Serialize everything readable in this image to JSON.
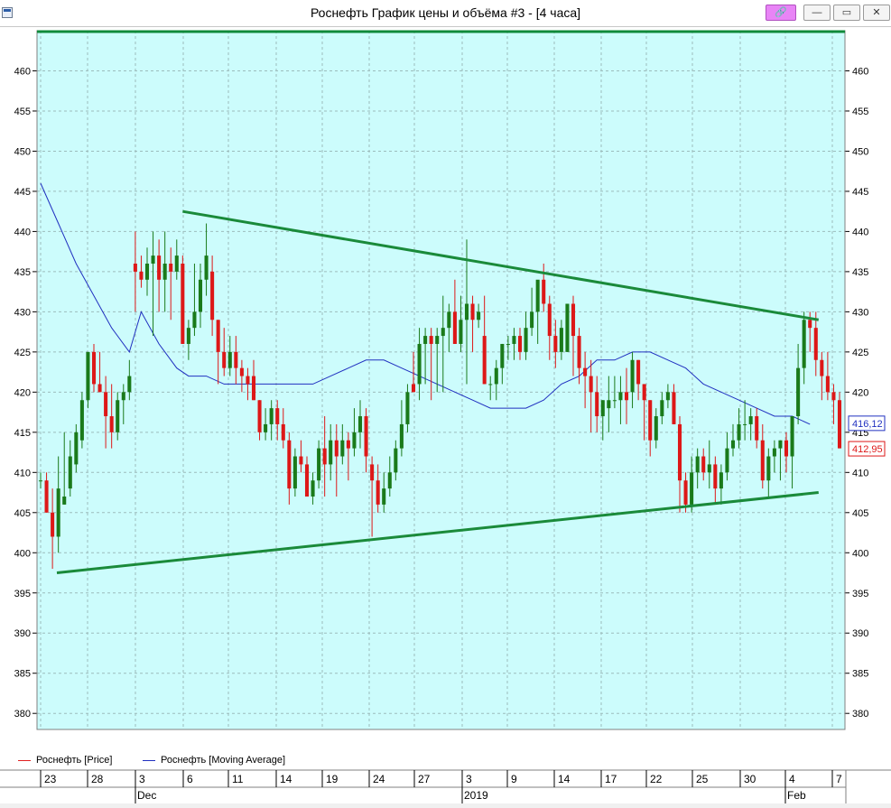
{
  "window": {
    "title": "Роснефть График цены и объёма #3 - [4 часа]",
    "buttons": {
      "link": "🔗",
      "minimize": "—",
      "maximize": "▭",
      "close": "✕"
    }
  },
  "legend": [
    {
      "label": "Роснефть [Price]",
      "color": "#e02020"
    },
    {
      "label": "Роснефть [Moving Average]",
      "color": "#2030c0"
    }
  ],
  "colors": {
    "background": "#ccfcfc",
    "up": "#1a7a1a",
    "down": "#dd1818",
    "trendline": "#1a8a3a",
    "ma": "#2030c0",
    "frame": "#0f8a3a",
    "grid": "#9cbcbc"
  },
  "chart_data": {
    "type": "candlestick",
    "ylim": [
      378,
      465
    ],
    "yticks": [
      380,
      385,
      390,
      395,
      400,
      405,
      410,
      415,
      420,
      425,
      430,
      435,
      440,
      445,
      450,
      455,
      460
    ],
    "xlabels": [
      "23",
      "28",
      "3",
      "6",
      "11",
      "14",
      "19",
      "24",
      "27",
      "3",
      "9",
      "14",
      "17",
      "22",
      "25",
      "30",
      "4",
      "7"
    ],
    "month_labels": [
      {
        "label": "Dec",
        "at": 2
      },
      {
        "label": "2019",
        "at": 9
      },
      {
        "label": "Feb",
        "at": 16
      }
    ],
    "last_price": "412,95",
    "last_ma": "416,12",
    "candles": [
      [
        409,
        410,
        408,
        409
      ],
      [
        409,
        410,
        405,
        405
      ],
      [
        405,
        408,
        398,
        402
      ],
      [
        402,
        412,
        400,
        408
      ],
      [
        406,
        415,
        406,
        407
      ],
      [
        408,
        414,
        407,
        412
      ],
      [
        411,
        416,
        410,
        415
      ],
      [
        414,
        420,
        413,
        419
      ],
      [
        419,
        425,
        418,
        425
      ],
      [
        425,
        426,
        420,
        421
      ],
      [
        421,
        425,
        420,
        420
      ],
      [
        420,
        422,
        413,
        417
      ],
      [
        417,
        421,
        413,
        415
      ],
      [
        415,
        420,
        414,
        419
      ],
      [
        419,
        421,
        416,
        420
      ],
      [
        420,
        424,
        419,
        422
      ],
      [
        436,
        440,
        430,
        435
      ],
      [
        435,
        437,
        433,
        434
      ],
      [
        434,
        438,
        432,
        436
      ],
      [
        436,
        440,
        427,
        437
      ],
      [
        437,
        439,
        430,
        434
      ],
      [
        434,
        440,
        430,
        436
      ],
      [
        436,
        438,
        429,
        435
      ],
      [
        435,
        439,
        434,
        437
      ],
      [
        436,
        437,
        426,
        426
      ],
      [
        426,
        429,
        424,
        428
      ],
      [
        428,
        436,
        427,
        430
      ],
      [
        430,
        436,
        428,
        434
      ],
      [
        434,
        441,
        432,
        437
      ],
      [
        435,
        437,
        427,
        429
      ],
      [
        429,
        429,
        421,
        425
      ],
      [
        425,
        428,
        422,
        423
      ],
      [
        423,
        427,
        422,
        425
      ],
      [
        425,
        427,
        421,
        423
      ],
      [
        423,
        424,
        420,
        422
      ],
      [
        422,
        423,
        419,
        421
      ],
      [
        422,
        424,
        419,
        419
      ],
      [
        419,
        419,
        414,
        415
      ],
      [
        415,
        418,
        414,
        416
      ],
      [
        416,
        419,
        414,
        418
      ],
      [
        418,
        419,
        414,
        416
      ],
      [
        416,
        418,
        413,
        414
      ],
      [
        414,
        415,
        406,
        408
      ],
      [
        408,
        413,
        407,
        412
      ],
      [
        412,
        414,
        410,
        411
      ],
      [
        411,
        412,
        407,
        407
      ],
      [
        407,
        410,
        406,
        409
      ],
      [
        409,
        414,
        408,
        413
      ],
      [
        413,
        417,
        407,
        411
      ],
      [
        411,
        416,
        409,
        414
      ],
      [
        414,
        416,
        407,
        412
      ],
      [
        412,
        416,
        411,
        414
      ],
      [
        414,
        415,
        409,
        413
      ],
      [
        413,
        418,
        412,
        415
      ],
      [
        415,
        419,
        413,
        417
      ],
      [
        417,
        418,
        410,
        412
      ],
      [
        411,
        412,
        402,
        409
      ],
      [
        409,
        411,
        405,
        406
      ],
      [
        406,
        410,
        405,
        408
      ],
      [
        408,
        412,
        407,
        410
      ],
      [
        410,
        414,
        409,
        413
      ],
      [
        413,
        419,
        412,
        416
      ],
      [
        416,
        421,
        415,
        420
      ],
      [
        421,
        425,
        420,
        420
      ],
      [
        421,
        428,
        419,
        426
      ],
      [
        426,
        428,
        421,
        427
      ],
      [
        427,
        428,
        419,
        426
      ],
      [
        426,
        428,
        420,
        427
      ],
      [
        427,
        432,
        420,
        428
      ],
      [
        428,
        431,
        425,
        430
      ],
      [
        430,
        434,
        426,
        426
      ],
      [
        426,
        432,
        425,
        429
      ],
      [
        429,
        439,
        421,
        431
      ],
      [
        431,
        432,
        425,
        429
      ],
      [
        429,
        431,
        428,
        430
      ],
      [
        427,
        432,
        421,
        421
      ],
      [
        421,
        422,
        419,
        421
      ],
      [
        421,
        424,
        419,
        423
      ],
      [
        423,
        426,
        421,
        426
      ],
      [
        426,
        427,
        424,
        426
      ],
      [
        426,
        428,
        424,
        427
      ],
      [
        427,
        428,
        424,
        425
      ],
      [
        425,
        430,
        424,
        428
      ],
      [
        428,
        433,
        427,
        430
      ],
      [
        430,
        432,
        426,
        434
      ],
      [
        434,
        436,
        430,
        431
      ],
      [
        431,
        432,
        424,
        427
      ],
      [
        427,
        429,
        423,
        425
      ],
      [
        425,
        429,
        424,
        428
      ],
      [
        425,
        431,
        425,
        431
      ],
      [
        431,
        432,
        422,
        427
      ],
      [
        427,
        428,
        421,
        423
      ],
      [
        423,
        425,
        418,
        422
      ],
      [
        422,
        424,
        415,
        420
      ],
      [
        420,
        422,
        415,
        417
      ],
      [
        417,
        419,
        414,
        419
      ],
      [
        418,
        422,
        415,
        419
      ],
      [
        419,
        422,
        418,
        419
      ],
      [
        419,
        422,
        416,
        420
      ],
      [
        420,
        423,
        416,
        419
      ],
      [
        420,
        425,
        418,
        424
      ],
      [
        424,
        424,
        419,
        421
      ],
      [
        421,
        421,
        414,
        419
      ],
      [
        419,
        419,
        412,
        414
      ],
      [
        414,
        418,
        413,
        417
      ],
      [
        417,
        420,
        416,
        419
      ],
      [
        419,
        421,
        418,
        420
      ],
      [
        420,
        421,
        416,
        416
      ],
      [
        416,
        417,
        405,
        409
      ],
      [
        409,
        410,
        405,
        406
      ],
      [
        406,
        412,
        405,
        410
      ],
      [
        410,
        413,
        408,
        412
      ],
      [
        412,
        413,
        409,
        410
      ],
      [
        410,
        414,
        408,
        411
      ],
      [
        411,
        412,
        406,
        408
      ],
      [
        408,
        411,
        406,
        410
      ],
      [
        410,
        415,
        409,
        413
      ],
      [
        413,
        416,
        412,
        414
      ],
      [
        414,
        418,
        413,
        416
      ],
      [
        416,
        419,
        414,
        416
      ],
      [
        416,
        418,
        414,
        417
      ],
      [
        417,
        418,
        413,
        414
      ],
      [
        414,
        416,
        408,
        409
      ],
      [
        409,
        413,
        407,
        412
      ],
      [
        412,
        414,
        410,
        413
      ],
      [
        413,
        414,
        409,
        414
      ],
      [
        414,
        415,
        410,
        412
      ],
      [
        412,
        415,
        408,
        417
      ],
      [
        417,
        426,
        416,
        423
      ],
      [
        423,
        430,
        421,
        429
      ],
      [
        429,
        430,
        425,
        428
      ],
      [
        428,
        430,
        422,
        424
      ],
      [
        424,
        425,
        419,
        422
      ],
      [
        422,
        425,
        419,
        420
      ],
      [
        420,
        421,
        416,
        419
      ],
      [
        419,
        420,
        413,
        413
      ]
    ],
    "ma_points": [
      [
        0,
        446
      ],
      [
        3,
        441
      ],
      [
        6,
        436
      ],
      [
        9,
        432
      ],
      [
        12,
        428
      ],
      [
        15,
        425
      ],
      [
        17,
        430
      ],
      [
        20,
        426
      ],
      [
        23,
        423
      ],
      [
        25,
        422
      ],
      [
        28,
        422
      ],
      [
        31,
        421
      ],
      [
        34,
        421
      ],
      [
        37,
        421
      ],
      [
        40,
        421
      ],
      [
        43,
        421
      ],
      [
        46,
        421
      ],
      [
        49,
        422
      ],
      [
        52,
        423
      ],
      [
        55,
        424
      ],
      [
        58,
        424
      ],
      [
        61,
        423
      ],
      [
        64,
        422
      ],
      [
        67,
        421
      ],
      [
        70,
        420
      ],
      [
        73,
        419
      ],
      [
        76,
        418
      ],
      [
        79,
        418
      ],
      [
        82,
        418
      ],
      [
        85,
        419
      ],
      [
        88,
        421
      ],
      [
        91,
        422
      ],
      [
        94,
        424
      ],
      [
        97,
        424
      ],
      [
        100,
        425
      ],
      [
        103,
        425
      ],
      [
        106,
        424
      ],
      [
        109,
        423
      ],
      [
        112,
        421
      ],
      [
        115,
        420
      ],
      [
        118,
        419
      ],
      [
        121,
        418
      ],
      [
        124,
        417
      ],
      [
        127,
        417
      ],
      [
        130,
        416
      ]
    ],
    "resistance": [
      [
        24,
        442.5
      ],
      [
        131,
        429
      ]
    ],
    "support": [
      [
        0,
        397.5
      ],
      [
        131,
        407.5
      ]
    ]
  }
}
